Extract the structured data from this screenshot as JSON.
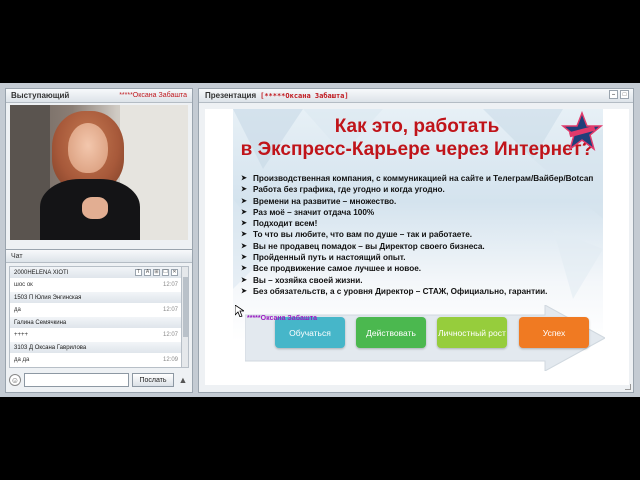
{
  "speaker": {
    "title": "Выступающий",
    "name": "*****Оксана Забашта"
  },
  "chat": {
    "title": "Чат",
    "messages": [
      {
        "author": "2000НELENA XIOTI",
        "text": "шос ок",
        "time": "12:07"
      },
      {
        "author": "1503 П Юлия Энгинская",
        "text": "да",
        "time": "12:07"
      },
      {
        "author": "Галина Семячкина",
        "text": "++++",
        "time": "12:07"
      },
      {
        "author": "3103 Д Оксана Гаврилова",
        "text": "да да",
        "time": "12:09"
      }
    ],
    "tools": [
      "T",
      "A",
      "⊞",
      "☐",
      "✕"
    ],
    "input_placeholder": "",
    "send_label": "Послать"
  },
  "presentation": {
    "title": "Презентация",
    "owner": "[*****Оксана Забашта]",
    "slide": {
      "title_line1": "Как это, работать",
      "title_line2": "в Экспресс-Карьере через Интернет?",
      "bullets": [
        "Производственная компания, с коммуникацией  на сайте и Телеграм/Вайбер/Вotcап",
        "Работа без графика, где угодно и когда угодно.",
        "Времени на развитие – множество.",
        "Раз моё – значит отдача 100%",
        "Подходит всем!",
        "То что вы любите, что вам по душе – так и работаете.",
        "Вы не продавец помадок – вы Директор своего бизнеса.",
        "Пройденный путь и настоящий опыт.",
        "Все продвижение самое лучшее и новое.",
        "Вы – хозяйка своей жизни.",
        "Без обязательств, а с уровня Директор – СТАЖ, Официально, гарантии."
      ],
      "steps": [
        "Обучаться",
        "Действовать",
        "Личностный рост",
        "Успех"
      ],
      "cursor_label": "*****Оксана Забашта"
    }
  },
  "colors": {
    "title_red": "#c0141a",
    "step1": "#46b6c9",
    "step2": "#4bb84f",
    "step3": "#96cd3c",
    "step4": "#f07a22",
    "cursor_label": "#9b1bc2"
  }
}
